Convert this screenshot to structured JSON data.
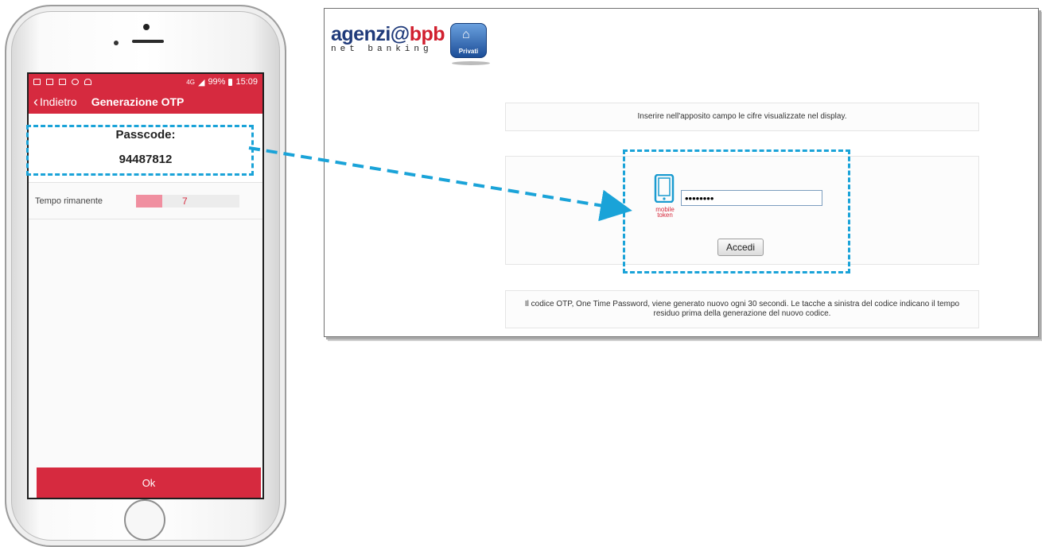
{
  "phone": {
    "status_bar": {
      "signal_text": "4G",
      "battery_text": "99%",
      "time": "15:09"
    },
    "header": {
      "back_label": "Indietro",
      "title": "Generazione OTP"
    },
    "passcode": {
      "label": "Passcode:",
      "value": "94487812"
    },
    "timer": {
      "label": "Tempo rimanente",
      "seconds": "7",
      "fill_fraction": 0.25
    },
    "ok_button": "Ok"
  },
  "browser": {
    "logo": {
      "main_part1": "agenzi@",
      "main_part2": "bpb",
      "sub": "net banking",
      "badge_label": "Privati"
    },
    "info_text": "Inserire nell'apposito campo le cifre visualizzate nel display.",
    "token_label": "mobile token",
    "password_value": "••••••••",
    "login_button": "Accedi",
    "note_text": "Il codice OTP, One Time Password, viene generato nuovo ogni 30 secondi. Le tacche a sinistra del codice indicano il tempo residuo prima della generazione del nuovo codice."
  },
  "colors": {
    "app_red": "#d62a3f",
    "highlight_blue": "#1aa3d8",
    "logo_blue": "#1f3a7a",
    "logo_red": "#d1202f"
  },
  "icons": [
    "home-icon",
    "mobile-token-icon",
    "back-chevron-icon",
    "battery-icon",
    "signal-icon"
  ]
}
